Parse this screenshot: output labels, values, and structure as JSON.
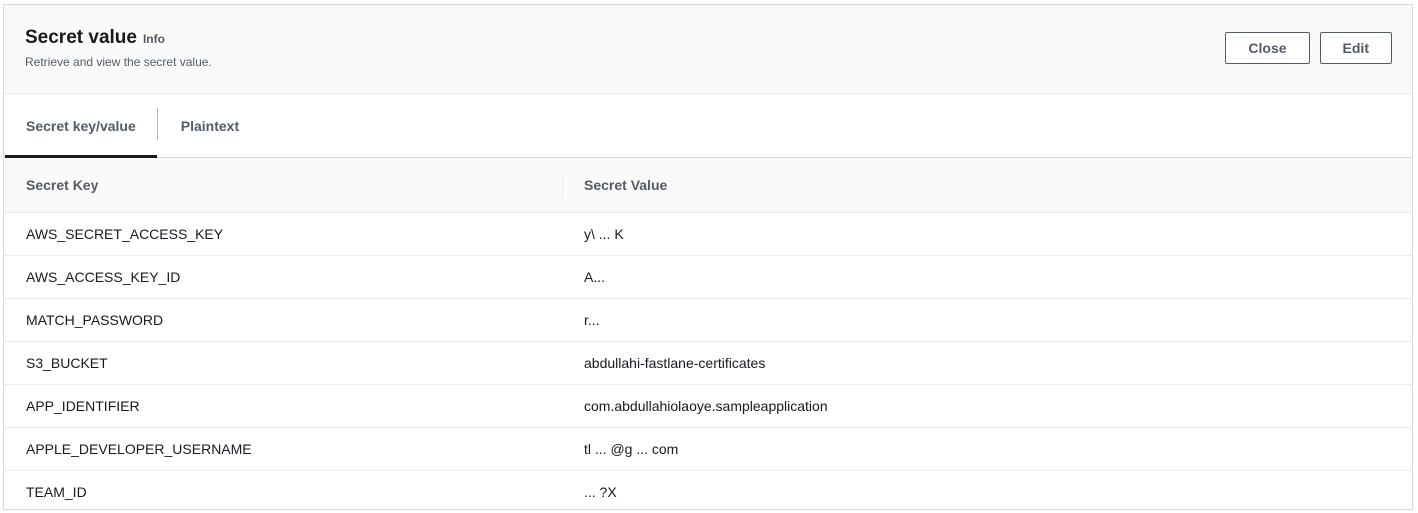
{
  "header": {
    "title": "Secret value",
    "info_link": "Info",
    "subtitle": "Retrieve and view the secret value.",
    "close_label": "Close",
    "edit_label": "Edit"
  },
  "tabs": [
    {
      "label": "Secret key/value",
      "active": true
    },
    {
      "label": "Plaintext",
      "active": false
    }
  ],
  "table": {
    "columns": [
      "Secret Key",
      "Secret Value"
    ],
    "rows": [
      {
        "key": "AWS_SECRET_ACCESS_KEY",
        "value": "y\\ ... K"
      },
      {
        "key": "AWS_ACCESS_KEY_ID",
        "value": "A..."
      },
      {
        "key": "MATCH_PASSWORD",
        "value": "r..."
      },
      {
        "key": "S3_BUCKET",
        "value": "abdullahi-fastlane-certificates"
      },
      {
        "key": "APP_IDENTIFIER",
        "value": "com.abdullahiolaoye.sampleapplication"
      },
      {
        "key": "APPLE_DEVELOPER_USERNAME",
        "value": "tl ... @g ... com"
      },
      {
        "key": "TEAM_ID",
        "value": "... ?X"
      }
    ]
  },
  "colors": {
    "header_bg": "#fafafa",
    "border": "#d5dbdb",
    "text": "#16191f",
    "muted": "#545b64"
  }
}
